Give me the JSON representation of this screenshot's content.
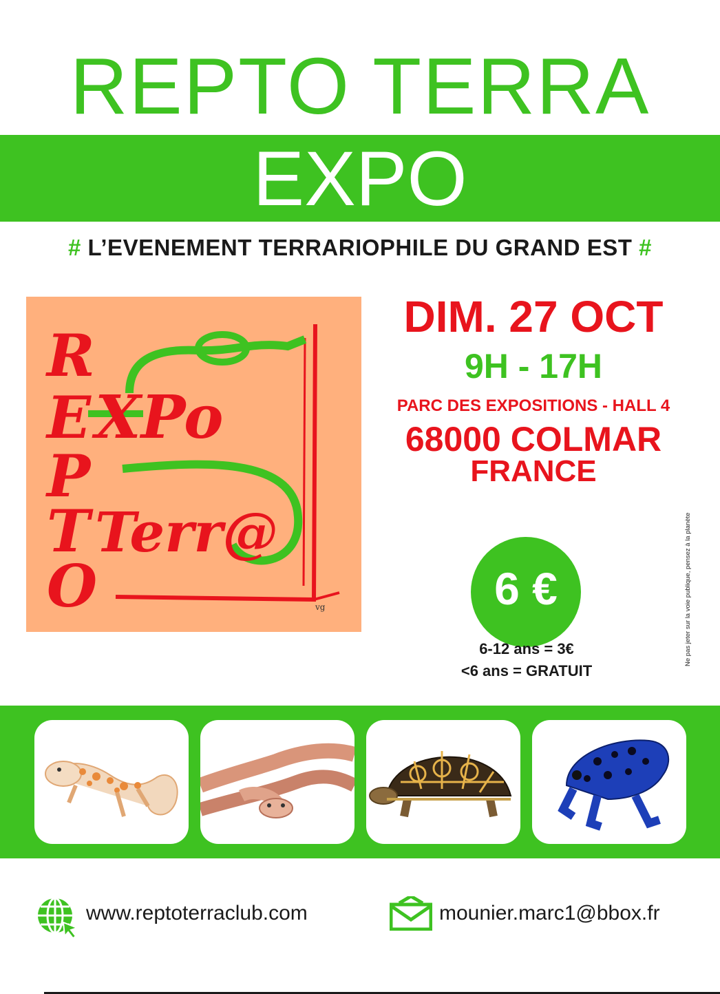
{
  "header": {
    "title": "REPTO TERRA",
    "subtitle": "EXPO",
    "tagline_hash": "#",
    "tagline": "L’EVENEMENT TERRARIOPHILE DU GRAND EST"
  },
  "logo": {
    "vertical_letters": [
      "R",
      "E",
      "P",
      "T",
      "O"
    ],
    "expo_word": "XPo",
    "terra_word": "Terr@",
    "signature": "vg"
  },
  "event": {
    "date": "DIM. 27 OCT",
    "hours": "9H - 17H",
    "venue": "PARC DES EXPOSITIONS - HALL 4",
    "city": "68000 COLMAR",
    "country": "FRANCE"
  },
  "pricing": {
    "price": "6 €",
    "child_rate": "6-12 ans = 3€",
    "under_six": "<6 ans = GRATUIT"
  },
  "side_note": "Ne pas jeter sur la voie publique, pensez à la planète",
  "animals": [
    "gecko",
    "snake",
    "tortoise",
    "poison-dart-frog"
  ],
  "contact": {
    "website": "www.reptoterraclub.com",
    "email": "mounier.marc1@bbox.fr"
  },
  "colors": {
    "green": "#3ec221",
    "red": "#e8141d",
    "logo_bg": "#ffb07d"
  }
}
